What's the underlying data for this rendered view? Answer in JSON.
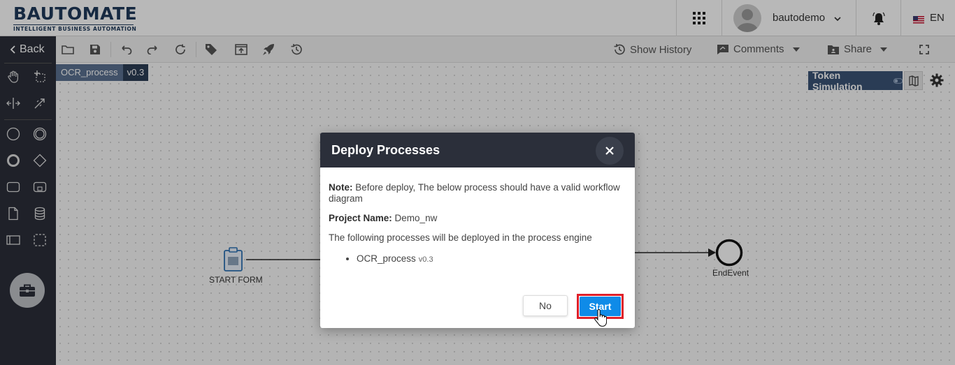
{
  "header": {
    "logo_main": "BAUTOMATE",
    "logo_sub": "INTELLIGENT BUSINESS AUTOMATION",
    "user_name": "bautodemo",
    "language": "EN"
  },
  "sidebar": {
    "back_label": "Back"
  },
  "toolbar": {
    "show_history": "Show History",
    "comments": "Comments",
    "share": "Share"
  },
  "process_tag": {
    "name": "OCR_process",
    "version": "v0.3"
  },
  "canvas": {
    "token_simulation": "Token Simulation",
    "start_label": "START FORM",
    "end_label": "EndEvent"
  },
  "modal": {
    "title": "Deploy Processes",
    "note_label": "Note:",
    "note_text": " Before deploy, The below process should have a valid workflow diagram",
    "project_label": "Project Name:",
    "project_value": " Demo_nw",
    "following_text": "The following processes will be deployed in the process engine",
    "process_items": [
      {
        "name": "OCR_process",
        "version": "v0.3"
      }
    ],
    "no_label": "No",
    "start_label": "Start"
  },
  "colors": {
    "sidebar_bg": "#2b2f3a",
    "accent_blue": "#0f8be8",
    "highlight_red": "#e0202a",
    "token_sim_bg": "#3b5477"
  }
}
